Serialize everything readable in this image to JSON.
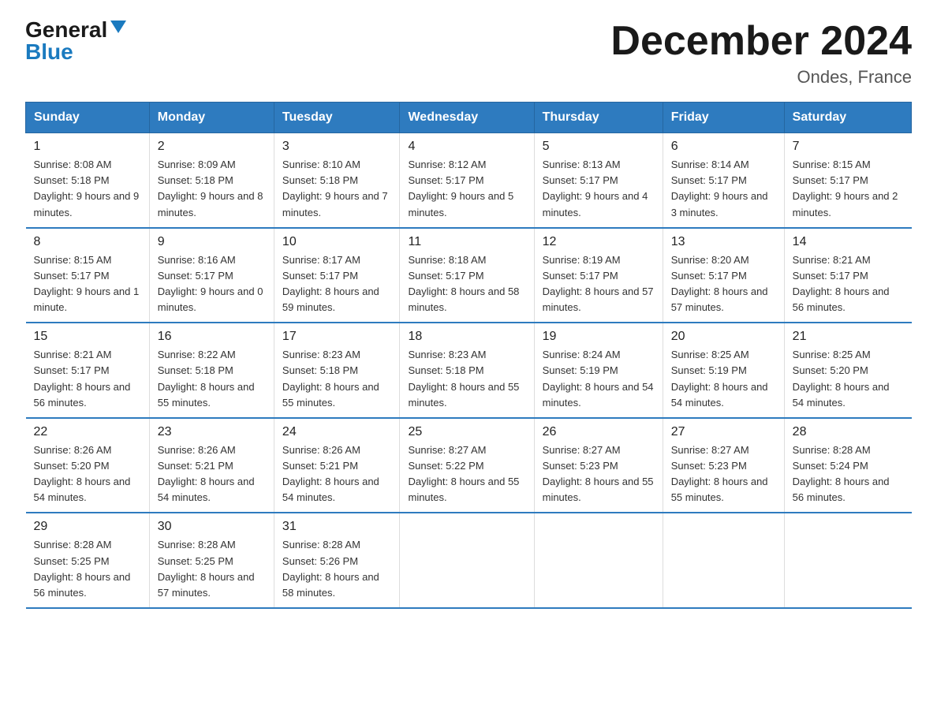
{
  "logo": {
    "general": "General",
    "blue": "Blue"
  },
  "header": {
    "month": "December 2024",
    "location": "Ondes, France"
  },
  "days_of_week": [
    "Sunday",
    "Monday",
    "Tuesday",
    "Wednesday",
    "Thursday",
    "Friday",
    "Saturday"
  ],
  "weeks": [
    [
      {
        "day": "1",
        "sunrise": "8:08 AM",
        "sunset": "5:18 PM",
        "daylight": "9 hours and 9 minutes."
      },
      {
        "day": "2",
        "sunrise": "8:09 AM",
        "sunset": "5:18 PM",
        "daylight": "9 hours and 8 minutes."
      },
      {
        "day": "3",
        "sunrise": "8:10 AM",
        "sunset": "5:18 PM",
        "daylight": "9 hours and 7 minutes."
      },
      {
        "day": "4",
        "sunrise": "8:12 AM",
        "sunset": "5:17 PM",
        "daylight": "9 hours and 5 minutes."
      },
      {
        "day": "5",
        "sunrise": "8:13 AM",
        "sunset": "5:17 PM",
        "daylight": "9 hours and 4 minutes."
      },
      {
        "day": "6",
        "sunrise": "8:14 AM",
        "sunset": "5:17 PM",
        "daylight": "9 hours and 3 minutes."
      },
      {
        "day": "7",
        "sunrise": "8:15 AM",
        "sunset": "5:17 PM",
        "daylight": "9 hours and 2 minutes."
      }
    ],
    [
      {
        "day": "8",
        "sunrise": "8:15 AM",
        "sunset": "5:17 PM",
        "daylight": "9 hours and 1 minute."
      },
      {
        "day": "9",
        "sunrise": "8:16 AM",
        "sunset": "5:17 PM",
        "daylight": "9 hours and 0 minutes."
      },
      {
        "day": "10",
        "sunrise": "8:17 AM",
        "sunset": "5:17 PM",
        "daylight": "8 hours and 59 minutes."
      },
      {
        "day": "11",
        "sunrise": "8:18 AM",
        "sunset": "5:17 PM",
        "daylight": "8 hours and 58 minutes."
      },
      {
        "day": "12",
        "sunrise": "8:19 AM",
        "sunset": "5:17 PM",
        "daylight": "8 hours and 57 minutes."
      },
      {
        "day": "13",
        "sunrise": "8:20 AM",
        "sunset": "5:17 PM",
        "daylight": "8 hours and 57 minutes."
      },
      {
        "day": "14",
        "sunrise": "8:21 AM",
        "sunset": "5:17 PM",
        "daylight": "8 hours and 56 minutes."
      }
    ],
    [
      {
        "day": "15",
        "sunrise": "8:21 AM",
        "sunset": "5:17 PM",
        "daylight": "8 hours and 56 minutes."
      },
      {
        "day": "16",
        "sunrise": "8:22 AM",
        "sunset": "5:18 PM",
        "daylight": "8 hours and 55 minutes."
      },
      {
        "day": "17",
        "sunrise": "8:23 AM",
        "sunset": "5:18 PM",
        "daylight": "8 hours and 55 minutes."
      },
      {
        "day": "18",
        "sunrise": "8:23 AM",
        "sunset": "5:18 PM",
        "daylight": "8 hours and 55 minutes."
      },
      {
        "day": "19",
        "sunrise": "8:24 AM",
        "sunset": "5:19 PM",
        "daylight": "8 hours and 54 minutes."
      },
      {
        "day": "20",
        "sunrise": "8:25 AM",
        "sunset": "5:19 PM",
        "daylight": "8 hours and 54 minutes."
      },
      {
        "day": "21",
        "sunrise": "8:25 AM",
        "sunset": "5:20 PM",
        "daylight": "8 hours and 54 minutes."
      }
    ],
    [
      {
        "day": "22",
        "sunrise": "8:26 AM",
        "sunset": "5:20 PM",
        "daylight": "8 hours and 54 minutes."
      },
      {
        "day": "23",
        "sunrise": "8:26 AM",
        "sunset": "5:21 PM",
        "daylight": "8 hours and 54 minutes."
      },
      {
        "day": "24",
        "sunrise": "8:26 AM",
        "sunset": "5:21 PM",
        "daylight": "8 hours and 54 minutes."
      },
      {
        "day": "25",
        "sunrise": "8:27 AM",
        "sunset": "5:22 PM",
        "daylight": "8 hours and 55 minutes."
      },
      {
        "day": "26",
        "sunrise": "8:27 AM",
        "sunset": "5:23 PM",
        "daylight": "8 hours and 55 minutes."
      },
      {
        "day": "27",
        "sunrise": "8:27 AM",
        "sunset": "5:23 PM",
        "daylight": "8 hours and 55 minutes."
      },
      {
        "day": "28",
        "sunrise": "8:28 AM",
        "sunset": "5:24 PM",
        "daylight": "8 hours and 56 minutes."
      }
    ],
    [
      {
        "day": "29",
        "sunrise": "8:28 AM",
        "sunset": "5:25 PM",
        "daylight": "8 hours and 56 minutes."
      },
      {
        "day": "30",
        "sunrise": "8:28 AM",
        "sunset": "5:25 PM",
        "daylight": "8 hours and 57 minutes."
      },
      {
        "day": "31",
        "sunrise": "8:28 AM",
        "sunset": "5:26 PM",
        "daylight": "8 hours and 58 minutes."
      },
      null,
      null,
      null,
      null
    ]
  ]
}
